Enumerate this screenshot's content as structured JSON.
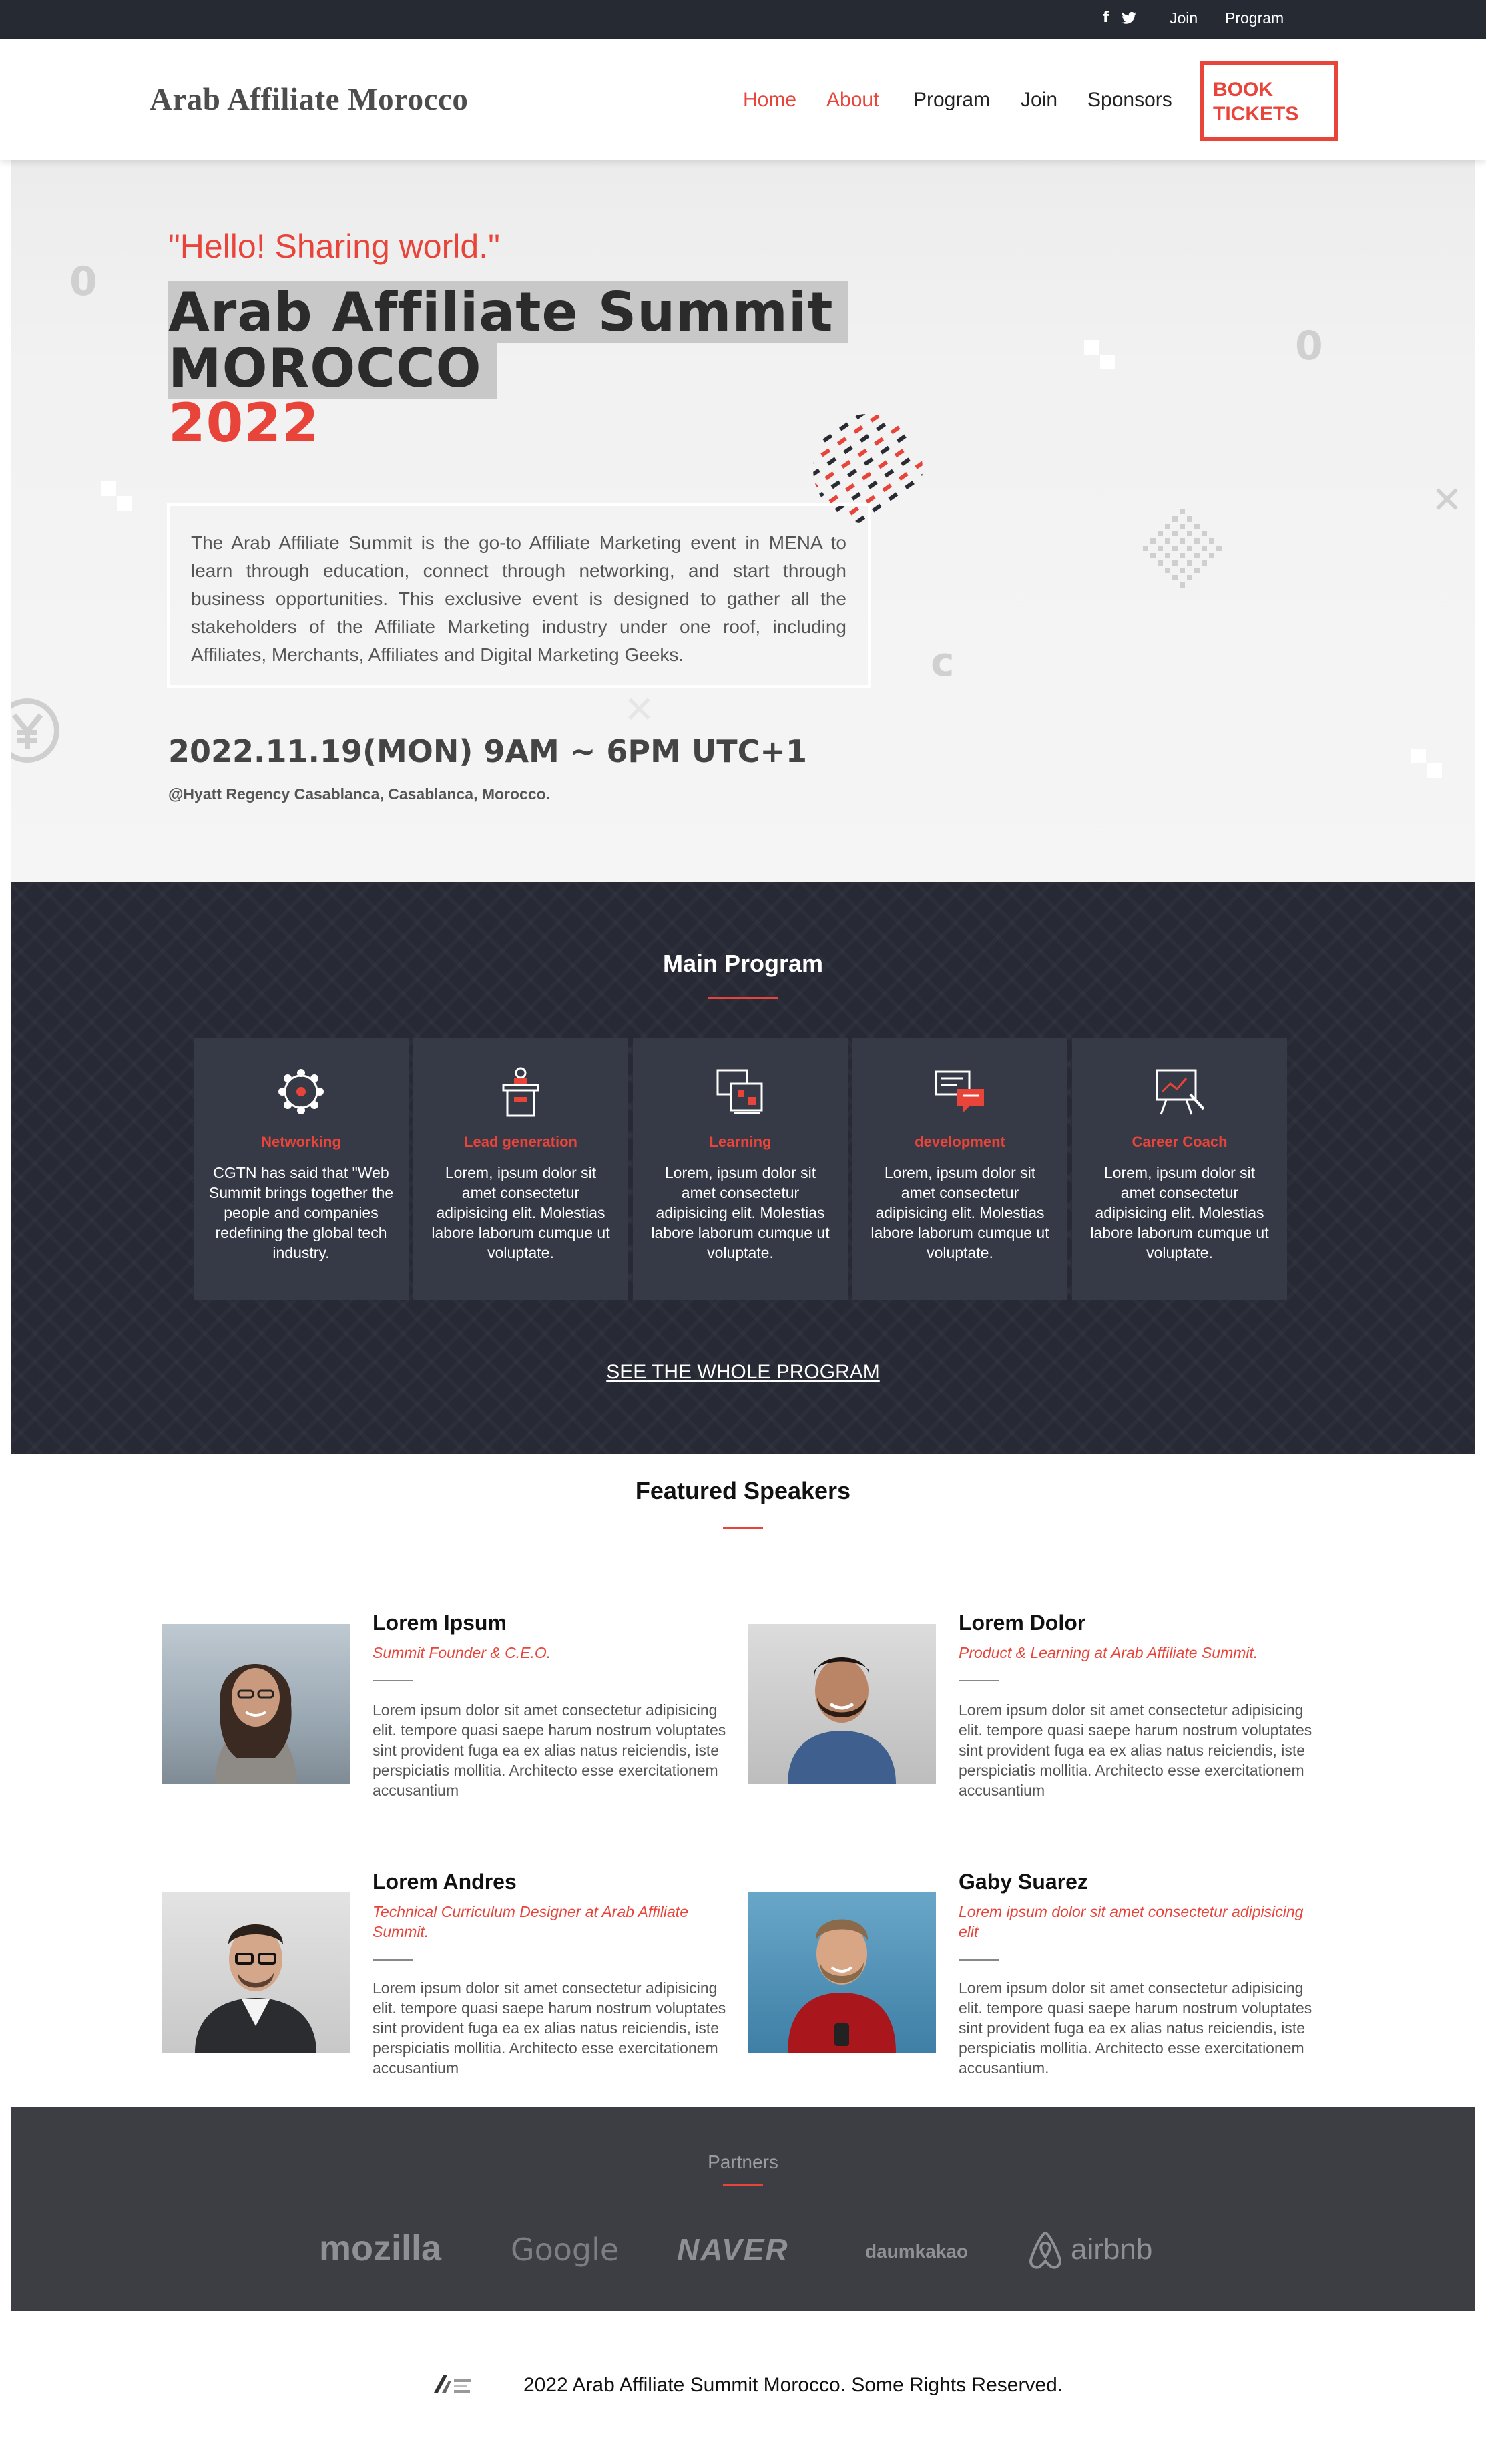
{
  "topbar": {
    "social": [
      "facebook-icon",
      "twitter-icon"
    ],
    "links": [
      "Join",
      "Program"
    ]
  },
  "header": {
    "logo": "Arab Affiliate Morocco",
    "nav": [
      "Home",
      "About",
      "Program",
      "Join",
      "Sponsors"
    ],
    "active_nav": [
      "Home",
      "About"
    ],
    "book_button": "BOOK TICKETS"
  },
  "hero": {
    "tagline": "\"Hello! Sharing world.\"",
    "title_line1": "Arab Affiliate Summit",
    "title_line2": "MOROCCO",
    "title_year": "2022",
    "description": "The Arab Affiliate Summit is the go-to Affiliate Marketing event in MENA to learn through education, connect through networking, and start through business opportunities. This exclusive event is designed to gather all the stakeholders of the Affiliate Marketing industry under one roof, including Affiliates, Merchants, Affiliates and Digital Marketing Geeks.",
    "date": "2022.11.19(MON) 9AM ~ 6PM UTC+1",
    "venue": "@Hyatt Regency Casablanca, Casablanca, Morocco."
  },
  "program": {
    "title": "Main Program",
    "cards": [
      {
        "icon": "network-icon",
        "name": "Networking",
        "text": "CGTN has said that \"Web Summit brings together the people and companies redefining the global tech industry."
      },
      {
        "icon": "podium-icon",
        "name": "Lead generation",
        "text": "Lorem, ipsum dolor sit amet consectetur adipisicing elit. Molestias labore laborum cumque ut voluptate."
      },
      {
        "icon": "learning-icon",
        "name": "Learning",
        "text": "Lorem, ipsum dolor sit amet consectetur adipisicing elit. Molestias labore laborum cumque ut voluptate."
      },
      {
        "icon": "chat-bubbles-icon",
        "name": "development",
        "text": "Lorem, ipsum dolor sit amet consectetur adipisicing elit. Molestias labore laborum cumque ut voluptate."
      },
      {
        "icon": "presentation-board-icon",
        "name": "Career Coach",
        "text": "Lorem, ipsum dolor sit amet consectetur adipisicing elit. Molestias labore laborum cumque ut voluptate."
      }
    ],
    "link": "SEE THE WHOLE PROGRAM"
  },
  "speakers": {
    "title": "Featured Speakers",
    "items": [
      {
        "name": "Lorem Ipsum",
        "role": "Summit Founder & C.E.O.",
        "bio": "Lorem ipsum dolor sit amet consectetur adipisicing elit. tempore quasi saepe harum nostrum voluptates sint provident fuga ea ex alias natus reiciendis, iste perspiciatis mollitia. Architecto esse exercitationem accusantium"
      },
      {
        "name": "Lorem Dolor",
        "role": "Product & Learning at Arab Affiliate Summit.",
        "bio": "Lorem ipsum dolor sit amet consectetur adipisicing elit. tempore quasi saepe harum nostrum voluptates sint provident fuga ea ex alias natus reiciendis, iste perspiciatis mollitia. Architecto esse exercitationem accusantium"
      },
      {
        "name": "Lorem Andres",
        "role": "Technical Curriculum Designer at Arab Affiliate Summit.",
        "bio": "Lorem ipsum dolor sit amet consectetur adipisicing elit. tempore quasi saepe harum nostrum voluptates sint provident fuga ea ex alias natus reiciendis, iste perspiciatis mollitia. Architecto esse exercitationem accusantium"
      },
      {
        "name": "Gaby Suarez",
        "role": "Lorem ipsum dolor sit amet consectetur adipisicing elit",
        "bio": "Lorem ipsum dolor sit amet consectetur adipisicing elit. tempore quasi saepe harum nostrum voluptates sint provident fuga ea ex alias natus reiciendis, iste perspiciatis mollitia. Architecto esse exercitationem accusantium."
      }
    ]
  },
  "partners": {
    "title": "Partners",
    "logos": [
      "mozilla",
      "Google",
      "NAVER",
      "daumkakao",
      "airbnb"
    ]
  },
  "footer": {
    "text": "2022 Arab Affiliate Summit Morocco. Some Rights Reserved."
  },
  "colors": {
    "accent": "#e8443a",
    "dark": "#262a33",
    "card": "#363946",
    "partners_bg": "#3d3e44"
  }
}
